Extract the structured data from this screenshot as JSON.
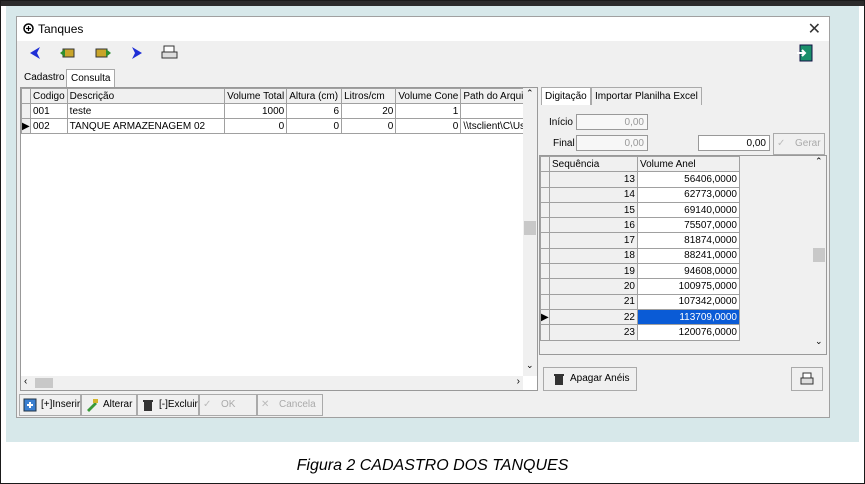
{
  "window": {
    "title": "Tanques"
  },
  "toolbar": {
    "icons": [
      "nav-prev-icon",
      "nav-first-icon",
      "nav-last-icon",
      "nav-next-icon",
      "print-icon",
      "exit-icon"
    ]
  },
  "left_tabs": [
    "Cadastro",
    "Consulta"
  ],
  "grid": {
    "headers": [
      "Codigo",
      "Descrição",
      "Volume Total",
      "Altura (cm)",
      "Litros/cm",
      "Volume Cone",
      "Path do Arquivo"
    ],
    "rows": [
      {
        "codigo": "001",
        "descricao": "teste",
        "volume_total": "1000",
        "altura": "6",
        "litros": "20",
        "volume_cone": "1",
        "path": ""
      },
      {
        "codigo": "002",
        "descricao": "TANQUE ARMAZENAGEM 02",
        "volume_total": "0",
        "altura": "0",
        "litros": "0",
        "volume_cone": "0",
        "path": "\\\\tsclient\\C\\Us"
      }
    ]
  },
  "bottom_buttons": {
    "inserir": "[+]Inserir",
    "alterar": "Alterar",
    "excluir": "[-]Excluir",
    "ok": "OK",
    "cancela": "Cancela"
  },
  "right_tabs": [
    "Digitação",
    "Importar Planilha Excel"
  ],
  "form": {
    "inicio_label": "Início",
    "inicio_value": "0,00",
    "final_label": "Final",
    "final_value": "0,00",
    "third_value": "0,00",
    "gerar": "Gerar"
  },
  "rgrid": {
    "headers": [
      "Sequência",
      "Volume Anel"
    ],
    "rows": [
      {
        "seq": "13",
        "vol": "56406,0000"
      },
      {
        "seq": "14",
        "vol": "62773,0000"
      },
      {
        "seq": "15",
        "vol": "69140,0000"
      },
      {
        "seq": "16",
        "vol": "75507,0000"
      },
      {
        "seq": "17",
        "vol": "81874,0000"
      },
      {
        "seq": "18",
        "vol": "88241,0000"
      },
      {
        "seq": "19",
        "vol": "94608,0000"
      },
      {
        "seq": "20",
        "vol": "100975,0000"
      },
      {
        "seq": "21",
        "vol": "107342,0000"
      },
      {
        "seq": "22",
        "vol": "113709,0000"
      },
      {
        "seq": "23",
        "vol": "120076,0000"
      }
    ]
  },
  "apagar": "Apagar Anéis",
  "caption": "Figura 2 CADASTRO DOS TANQUES"
}
